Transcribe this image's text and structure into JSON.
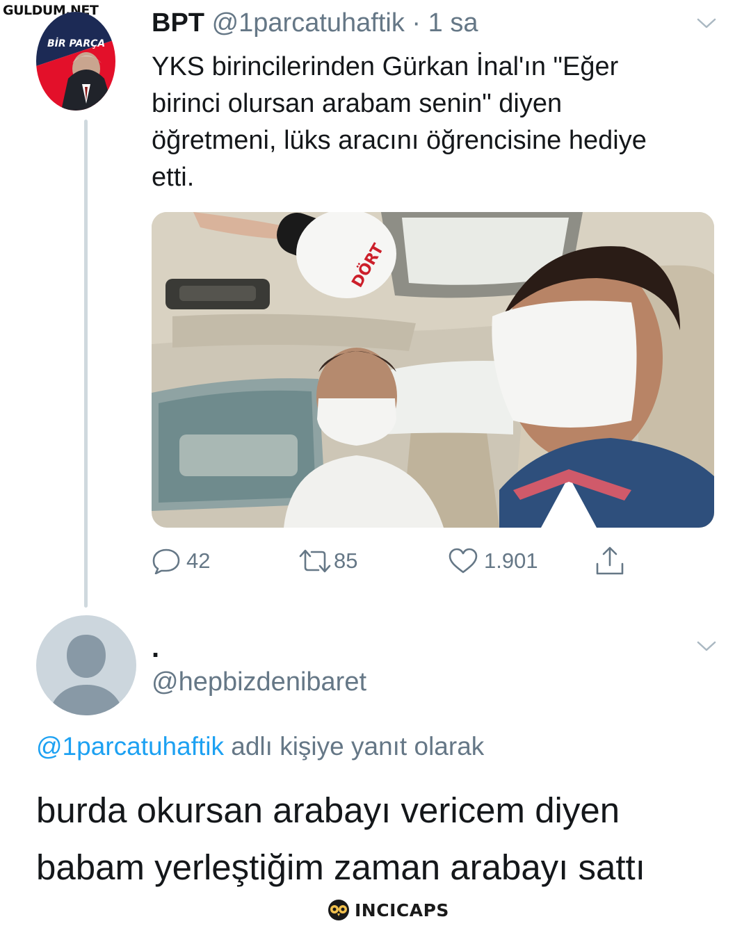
{
  "watermark_top": "GULDUM.NET",
  "watermark_bottom": "INCICAPS",
  "tweet": {
    "display_name": "BPT",
    "handle": "@1parcatuhaftik",
    "separator": "·",
    "time": "1 sa",
    "avatar_text": "BİR PARÇA",
    "text_lines": [
      "YKS birincilerinden Gürkan İnal'ın \"Eğer",
      "birinci olursan arabam senin\" diyen",
      "öğretmeni, lüks aracını öğrencisine hediye",
      "etti."
    ],
    "media_mic_label": "DÖRT",
    "actions": {
      "reply_count": "42",
      "retweet_count": "85",
      "like_count": "1.901"
    }
  },
  "reply": {
    "display_name": ".",
    "handle": "@hepbizdenibaret",
    "replying_to_handle": "@1parcatuhaftik",
    "replying_to_suffix": " adlı kişiye yanıt olarak",
    "text_lines": [
      "burda okursan arabayı vericem diyen",
      "babam yerleştiğim zaman arabayı sattı"
    ]
  },
  "colors": {
    "text_primary": "#14171a",
    "text_secondary": "#657786",
    "link": "#1da1f2",
    "thread_line": "#cfd9de",
    "avatar_red": "#e3102a",
    "avatar_navy": "#1c2a55"
  }
}
